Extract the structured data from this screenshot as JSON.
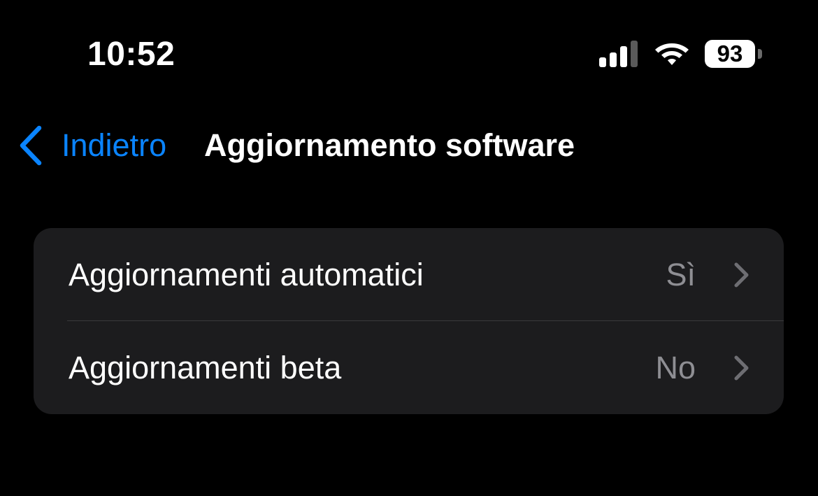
{
  "status_bar": {
    "time": "10:52",
    "battery_level": "93",
    "icons": [
      "cellular-signal-icon",
      "wifi-icon",
      "battery-icon"
    ]
  },
  "nav": {
    "back_label": "Indietro",
    "title": "Aggiornamento software",
    "accent_color": "#0a84ff"
  },
  "settings": {
    "rows": [
      {
        "label": "Aggiornamenti automatici",
        "value": "Sì",
        "icon": "chevron-right-icon"
      },
      {
        "label": "Aggiornamenti beta",
        "value": "No",
        "icon": "chevron-right-icon"
      }
    ]
  },
  "colors": {
    "background": "#000000",
    "group_background": "#1c1c1e",
    "secondary_text": "#8e8e93"
  }
}
